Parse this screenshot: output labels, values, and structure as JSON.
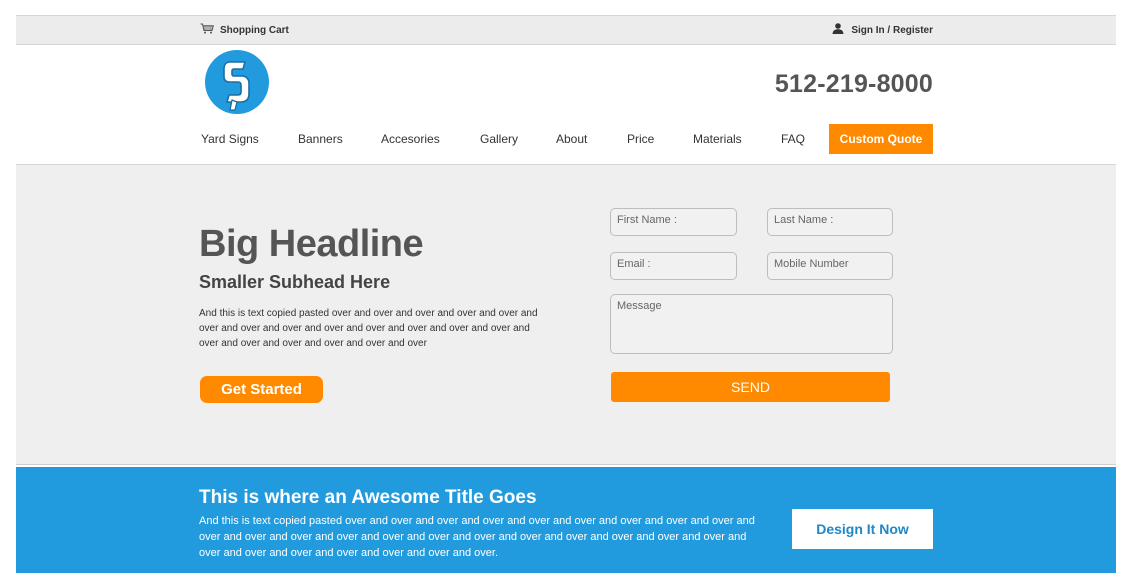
{
  "topbar": {
    "cart_icon": "cart-icon",
    "cart_label": "Shopping Cart",
    "user_icon": "user-icon",
    "signin_label": "Sign In / Register"
  },
  "header": {
    "logo_icon": "logo-s-icon",
    "phone": "512-219-8000"
  },
  "nav": {
    "items": [
      "Yard Signs",
      "Banners",
      "Accesories",
      "Gallery",
      "About",
      "Price",
      "Materials",
      "FAQ"
    ],
    "cta": "Custom Quote"
  },
  "hero": {
    "headline": "Big Headline",
    "subhead": "Smaller Subhead Here",
    "body": "And this is text copied pasted over and over and over and over and over and over and over and over and over and over and over and over and over and over and over and over and over and over and over",
    "cta": "Get Started"
  },
  "form": {
    "first_name_placeholder": "First Name :",
    "last_name_placeholder": "Last Name :",
    "email_placeholder": "Email :",
    "mobile_placeholder": "Mobile Number",
    "message_placeholder": "Message",
    "send_label": "SEND"
  },
  "banner": {
    "title": "This is where an Awesome Title Goes",
    "text": "And this is text copied pasted over and over and over and over and over and over and over and over and over and over and over and over and over and over and over and over and over and over and over and over and over and over and over and over and over and over and over and over.",
    "cta": "Design It Now"
  },
  "colors": {
    "accent": "#ff8a00",
    "banner_blue": "#219bdd",
    "hero_bg": "#efeff0",
    "text_dark": "#555555"
  }
}
